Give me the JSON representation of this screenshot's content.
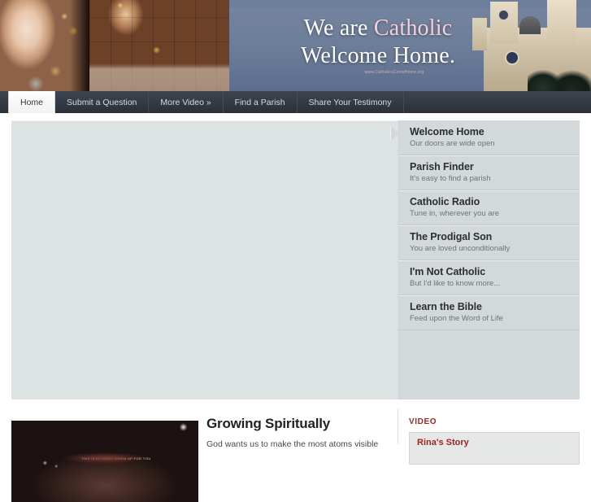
{
  "banner": {
    "headline_line1_white": "We are ",
    "headline_line1_pink": "Catholic",
    "headline_line2": "Welcome Home.",
    "url_text": "www.CatholicsComeHome.org"
  },
  "nav": {
    "items": [
      {
        "label": "Home",
        "active": true
      },
      {
        "label": "Submit a Question",
        "active": false
      },
      {
        "label": "More Video »",
        "active": false
      },
      {
        "label": "Find a Parish",
        "active": false
      },
      {
        "label": "Share Your Testimony",
        "active": false
      }
    ]
  },
  "features": {
    "items": [
      {
        "title": "Welcome Home",
        "subtitle": "Our doors are wide open",
        "active": true
      },
      {
        "title": "Parish Finder",
        "subtitle": "It's easy to find a parish",
        "active": false
      },
      {
        "title": "Catholic Radio",
        "subtitle": "Tune in, wherever you are",
        "active": false
      },
      {
        "title": "The Prodigal Son",
        "subtitle": "You are loved unconditionally",
        "active": false
      },
      {
        "title": "I'm Not Catholic",
        "subtitle": "But I'd like to know more...",
        "active": false
      },
      {
        "title": "Learn the Bible",
        "subtitle": "Feed upon the Word of Life",
        "active": false
      }
    ]
  },
  "article": {
    "title": "Growing Spiritually",
    "body": "God wants us to make the most atoms visible",
    "thumb_band_text": "THIS IS MY BODY GIVEN UP FOR YOU"
  },
  "video": {
    "label": "VIDEO",
    "card_title": "Rina's Story"
  },
  "colors": {
    "nav_bg": "#343b45",
    "panel_bg": "#dde2e3",
    "sidebar_bg": "#d3d8da",
    "accent_red": "#9e2421",
    "headline_pink": "#f6cfdc"
  }
}
